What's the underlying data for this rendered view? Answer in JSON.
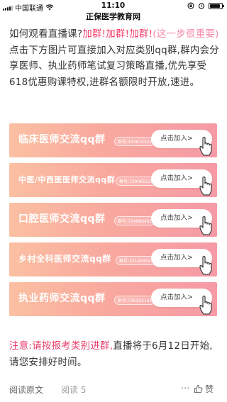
{
  "status_bar": {
    "carrier": "中国联通",
    "time": "11:10"
  },
  "nav": {
    "title": "正保医学教育网"
  },
  "article": {
    "intro_q": "如何观看直播课?",
    "intro_red": "加群!加群!加群!",
    "intro_pink": "(这一步很重要)",
    "intro_rest": "点击下方图片可直接加入对应类别qq群,群内会分享医师、执业药师笔试复习策略直播,优先享受618优惠购课特权,进群名额限时开放,速进。"
  },
  "banners": [
    {
      "title": "临床医师交流qq群",
      "group": "群号:433615329",
      "button": "点击加入>"
    },
    {
      "title": "中医/中西医医师交流qq群",
      "group": "群号:729065120",
      "button": "点击加入>"
    },
    {
      "title": "口腔医师交流qq群",
      "group": "群号:724686461",
      "button": "点击加入>"
    },
    {
      "title": "乡村全科医师交流qq群",
      "group": "群号:321459524",
      "button": "点击加入>"
    },
    {
      "title": "执业药师交流qq群",
      "group": "群号:726202141",
      "button": "点击加入>"
    }
  ],
  "notice": {
    "red": "注意:请按报考类别进群,",
    "rest": "直播将于6月12日开始,请您安排好时间。"
  },
  "footer": {
    "read_original": "阅读原文",
    "reads": "阅读 5",
    "more": "···",
    "like": "赞"
  },
  "colors": {
    "accent_red": "#f53d6b",
    "accent_pink": "#f58aa6",
    "banner_start": "#fbc0a2",
    "banner_end": "#f69aa6"
  }
}
